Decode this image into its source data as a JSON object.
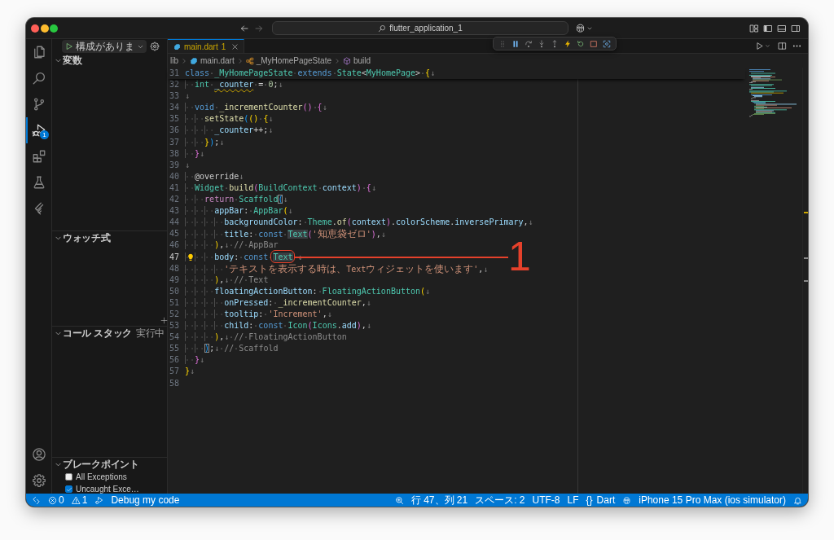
{
  "window": {
    "title": "flutter_application_1"
  },
  "activity_bar": {
    "items": [
      {
        "kind": "explorer",
        "selected": false
      },
      {
        "kind": "search",
        "selected": false
      },
      {
        "kind": "source-control",
        "selected": false
      },
      {
        "kind": "run-debug",
        "selected": true,
        "badge": "1"
      },
      {
        "kind": "extensions",
        "selected": false
      },
      {
        "kind": "testing",
        "selected": false
      },
      {
        "kind": "flutter",
        "selected": false
      }
    ],
    "bottom": [
      {
        "kind": "account"
      },
      {
        "kind": "manage"
      }
    ]
  },
  "sidebar": {
    "run_button": {
      "label": "構成がありま"
    },
    "sections": [
      {
        "title": "変数",
        "expanded": true
      },
      {
        "title": "ウォッチ式",
        "expanded": true
      },
      {
        "title": "コール スタック",
        "expanded": true,
        "status": "実行中"
      },
      {
        "title": "ブレークポイント",
        "expanded": true,
        "items": [
          {
            "label": "All Exceptions",
            "checked": false
          },
          {
            "label": "Uncaught Exce…",
            "checked": true
          }
        ]
      }
    ]
  },
  "editor": {
    "tabs": [
      {
        "label": "main.dart",
        "problems": "1",
        "selected": true
      }
    ],
    "breadcrumbs": [
      {
        "kind": "folder",
        "label": "lib"
      },
      {
        "kind": "dart-file",
        "label": "main.dart"
      },
      {
        "kind": "class",
        "label": "_MyHomePageState"
      },
      {
        "kind": "method",
        "label": "build"
      }
    ],
    "sticky_line": {
      "number": "31",
      "tokens": [
        {
          "text": "class ",
          "kind": "kw"
        },
        {
          "text": "_MyHomePageState ",
          "kind": "type"
        },
        {
          "text": "extends ",
          "kind": "kw"
        },
        {
          "text": "State",
          "kind": "type"
        },
        {
          "text": "<",
          "kind": "plain"
        },
        {
          "text": "MyHomePage",
          "kind": "type"
        },
        {
          "text": "> ",
          "kind": "plain"
        },
        {
          "text": "{",
          "kind": "b1"
        },
        {
          "text": "↓",
          "kind": "eol"
        }
      ]
    },
    "lines": [
      {
        "number": "32",
        "current": false,
        "lightbulb": false,
        "tokens": [
          {
            "text": "  int ",
            "kind": "type"
          },
          {
            "text": "_counter",
            "kind": "warn-var"
          },
          {
            "text": " = ",
            "kind": "plain"
          },
          {
            "text": "0",
            "kind": "num"
          },
          {
            "text": ";",
            "kind": "plain"
          },
          {
            "text": "↓",
            "kind": "eol"
          }
        ]
      },
      {
        "number": "33",
        "current": false,
        "lightbulb": false,
        "tokens": [
          {
            "text": "↓",
            "kind": "eol"
          }
        ]
      },
      {
        "number": "34",
        "current": false,
        "lightbulb": false,
        "tokens": [
          {
            "text": "  void ",
            "kind": "kw"
          },
          {
            "text": "_incrementCounter",
            "kind": "fn"
          },
          {
            "text": "() ",
            "kind": "b2"
          },
          {
            "text": "{",
            "kind": "b2"
          },
          {
            "text": "↓",
            "kind": "eol"
          }
        ]
      },
      {
        "number": "35",
        "current": false,
        "lightbulb": false,
        "tokens": [
          {
            "text": "    setState",
            "kind": "fn"
          },
          {
            "text": "(",
            "kind": "b3"
          },
          {
            "text": "() ",
            "kind": "b1"
          },
          {
            "text": "{",
            "kind": "b1"
          },
          {
            "text": "↓",
            "kind": "eol"
          }
        ]
      },
      {
        "number": "36",
        "current": false,
        "lightbulb": false,
        "tokens": [
          {
            "text": "      _counter",
            "kind": "var"
          },
          {
            "text": "++;",
            "kind": "plain"
          },
          {
            "text": "↓",
            "kind": "eol"
          }
        ]
      },
      {
        "number": "37",
        "current": false,
        "lightbulb": false,
        "tokens": [
          {
            "text": "    }",
            "kind": "b1"
          },
          {
            "text": ")",
            "kind": "b3"
          },
          {
            "text": ";",
            "kind": "plain"
          },
          {
            "text": "↓",
            "kind": "eol"
          }
        ]
      },
      {
        "number": "38",
        "current": false,
        "lightbulb": false,
        "tokens": [
          {
            "text": "  }",
            "kind": "b2"
          },
          {
            "text": "↓",
            "kind": "eol"
          }
        ]
      },
      {
        "number": "39",
        "current": false,
        "lightbulb": false,
        "tokens": [
          {
            "text": "↓",
            "kind": "eol"
          }
        ]
      },
      {
        "number": "40",
        "current": false,
        "lightbulb": false,
        "tokens": [
          {
            "text": "  @override",
            "kind": "plain"
          },
          {
            "text": "↓",
            "kind": "eol"
          }
        ]
      },
      {
        "number": "41",
        "current": false,
        "lightbulb": false,
        "tokens": [
          {
            "text": "  Widget ",
            "kind": "type"
          },
          {
            "text": "build",
            "kind": "fn"
          },
          {
            "text": "(",
            "kind": "b2"
          },
          {
            "text": "BuildContext ",
            "kind": "type"
          },
          {
            "text": "context",
            "kind": "var"
          },
          {
            "text": ") ",
            "kind": "b2"
          },
          {
            "text": "{",
            "kind": "b2"
          },
          {
            "text": "↓",
            "kind": "eol"
          }
        ]
      },
      {
        "number": "42",
        "current": false,
        "lightbulb": false,
        "tokens": [
          {
            "text": "    return ",
            "kind": "ctrl"
          },
          {
            "text": "Scaffold",
            "kind": "type"
          },
          {
            "text": "(",
            "kind": "b3-boxed"
          },
          {
            "text": "↓",
            "kind": "eol"
          }
        ]
      },
      {
        "number": "43",
        "current": false,
        "lightbulb": false,
        "tokens": [
          {
            "text": "      appBar",
            "kind": "var"
          },
          {
            "text": ": ",
            "kind": "plain"
          },
          {
            "text": "AppBar",
            "kind": "type"
          },
          {
            "text": "(",
            "kind": "b1"
          },
          {
            "text": "↓",
            "kind": "eol"
          }
        ]
      },
      {
        "number": "44",
        "current": false,
        "lightbulb": false,
        "tokens": [
          {
            "text": "        backgroundColor",
            "kind": "var"
          },
          {
            "text": ": ",
            "kind": "plain"
          },
          {
            "text": "Theme",
            "kind": "type"
          },
          {
            "text": ".",
            "kind": "plain"
          },
          {
            "text": "of",
            "kind": "fn"
          },
          {
            "text": "(",
            "kind": "b2"
          },
          {
            "text": "context",
            "kind": "var"
          },
          {
            "text": ")",
            "kind": "b2"
          },
          {
            "text": ".",
            "kind": "plain"
          },
          {
            "text": "colorScheme",
            "kind": "var"
          },
          {
            "text": ".",
            "kind": "plain"
          },
          {
            "text": "inversePrimary",
            "kind": "var"
          },
          {
            "text": ",",
            "kind": "plain"
          },
          {
            "text": "↓",
            "kind": "eol"
          }
        ]
      },
      {
        "number": "45",
        "current": false,
        "lightbulb": false,
        "tokens": [
          {
            "text": "        title",
            "kind": "var"
          },
          {
            "text": ": ",
            "kind": "plain"
          },
          {
            "text": "const ",
            "kind": "kw"
          },
          {
            "text": "Text",
            "kind": "match"
          },
          {
            "text": "(",
            "kind": "b2"
          },
          {
            "text": "'知恵袋ゼロ'",
            "kind": "str"
          },
          {
            "text": ")",
            "kind": "b2"
          },
          {
            "text": ",",
            "kind": "plain"
          },
          {
            "text": "↓",
            "kind": "eol"
          }
        ]
      },
      {
        "number": "46",
        "current": false,
        "lightbulb": false,
        "tokens": [
          {
            "text": "      )",
            "kind": "b1"
          },
          {
            "text": ",",
            "kind": "plain"
          },
          {
            "text": "↓",
            "kind": "eol"
          },
          {
            "text": " // AppBar",
            "kind": "label"
          }
        ]
      },
      {
        "number": "47",
        "current": true,
        "lightbulb": true,
        "tokens": [
          {
            "text": "      body",
            "kind": "var"
          },
          {
            "text": ": ",
            "kind": "plain"
          },
          {
            "text": "const ",
            "kind": "kw"
          },
          {
            "text": "Text",
            "kind": "circled"
          },
          {
            "text": " ↓",
            "kind": "eol"
          }
        ]
      },
      {
        "number": "48",
        "current": false,
        "lightbulb": false,
        "tokens": [
          {
            "text": "        'テキストを表示する時は、Textウィジェットを使います'",
            "kind": "str"
          },
          {
            "text": ",",
            "kind": "plain"
          },
          {
            "text": "↓",
            "kind": "eol"
          }
        ]
      },
      {
        "number": "49",
        "current": false,
        "lightbulb": false,
        "tokens": [
          {
            "text": "      )",
            "kind": "b1"
          },
          {
            "text": ",",
            "kind": "plain"
          },
          {
            "text": "↓",
            "kind": "eol"
          },
          {
            "text": " // Text",
            "kind": "label"
          }
        ]
      },
      {
        "number": "50",
        "current": false,
        "lightbulb": false,
        "tokens": [
          {
            "text": "      floatingActionButton",
            "kind": "var"
          },
          {
            "text": ": ",
            "kind": "plain"
          },
          {
            "text": "FloatingActionButton",
            "kind": "type"
          },
          {
            "text": "(",
            "kind": "b1"
          },
          {
            "text": "↓",
            "kind": "eol"
          }
        ]
      },
      {
        "number": "51",
        "current": false,
        "lightbulb": false,
        "tokens": [
          {
            "text": "        onPressed",
            "kind": "var"
          },
          {
            "text": ": ",
            "kind": "plain"
          },
          {
            "text": "_incrementCounter",
            "kind": "fn"
          },
          {
            "text": ",",
            "kind": "plain"
          },
          {
            "text": "↓",
            "kind": "eol"
          }
        ]
      },
      {
        "number": "52",
        "current": false,
        "lightbulb": false,
        "tokens": [
          {
            "text": "        tooltip",
            "kind": "var"
          },
          {
            "text": ": ",
            "kind": "plain"
          },
          {
            "text": "'Increment'",
            "kind": "str"
          },
          {
            "text": ",",
            "kind": "plain"
          },
          {
            "text": "↓",
            "kind": "eol"
          }
        ]
      },
      {
        "number": "53",
        "current": false,
        "lightbulb": false,
        "tokens": [
          {
            "text": "        child",
            "kind": "var"
          },
          {
            "text": ": ",
            "kind": "plain"
          },
          {
            "text": "const ",
            "kind": "kw"
          },
          {
            "text": "Icon",
            "kind": "type"
          },
          {
            "text": "(",
            "kind": "b2"
          },
          {
            "text": "Icons",
            "kind": "type"
          },
          {
            "text": ".",
            "kind": "plain"
          },
          {
            "text": "add",
            "kind": "var"
          },
          {
            "text": ")",
            "kind": "b2"
          },
          {
            "text": ",",
            "kind": "plain"
          },
          {
            "text": "↓",
            "kind": "eol"
          }
        ]
      },
      {
        "number": "54",
        "current": false,
        "lightbulb": false,
        "tokens": [
          {
            "text": "      )",
            "kind": "b1"
          },
          {
            "text": ",",
            "kind": "plain"
          },
          {
            "text": "↓",
            "kind": "eol"
          },
          {
            "text": " // FloatingActionButton",
            "kind": "label"
          }
        ]
      },
      {
        "number": "55",
        "current": false,
        "lightbulb": false,
        "tokens": [
          {
            "text": "    )",
            "kind": "b3-boxed"
          },
          {
            "text": ";",
            "kind": "plain"
          },
          {
            "text": "↓",
            "kind": "eol"
          },
          {
            "text": " // Scaffold",
            "kind": "label"
          }
        ]
      },
      {
        "number": "56",
        "current": false,
        "lightbulb": false,
        "tokens": [
          {
            "text": "  }",
            "kind": "b2"
          },
          {
            "text": "↓",
            "kind": "eol"
          }
        ]
      },
      {
        "number": "57",
        "current": false,
        "lightbulb": false,
        "tokens": [
          {
            "text": "}",
            "kind": "b1"
          },
          {
            "text": "↓",
            "kind": "eol"
          }
        ]
      },
      {
        "number": "58",
        "current": false,
        "lightbulb": false
      }
    ],
    "annotation": {
      "label": "1"
    }
  },
  "status_bar": {
    "left": [
      {
        "kind": "remote"
      },
      {
        "kind": "errors",
        "text": "0"
      },
      {
        "kind": "warnings",
        "text": "1"
      },
      {
        "kind": "debug"
      },
      {
        "kind": "text",
        "text": "Debug my code"
      }
    ],
    "right": [
      {
        "kind": "zoom"
      },
      {
        "kind": "text",
        "text": "行 47、列 21"
      },
      {
        "kind": "text",
        "text": "スペース: 2"
      },
      {
        "kind": "text",
        "text": "UTF-8"
      },
      {
        "kind": "text",
        "text": "LF"
      },
      {
        "kind": "language",
        "icon": "{}",
        "text": "Dart"
      },
      {
        "kind": "copilot"
      },
      {
        "kind": "text",
        "text": "iPhone 15 Pro Max (ios simulator)"
      },
      {
        "kind": "bell"
      }
    ]
  }
}
